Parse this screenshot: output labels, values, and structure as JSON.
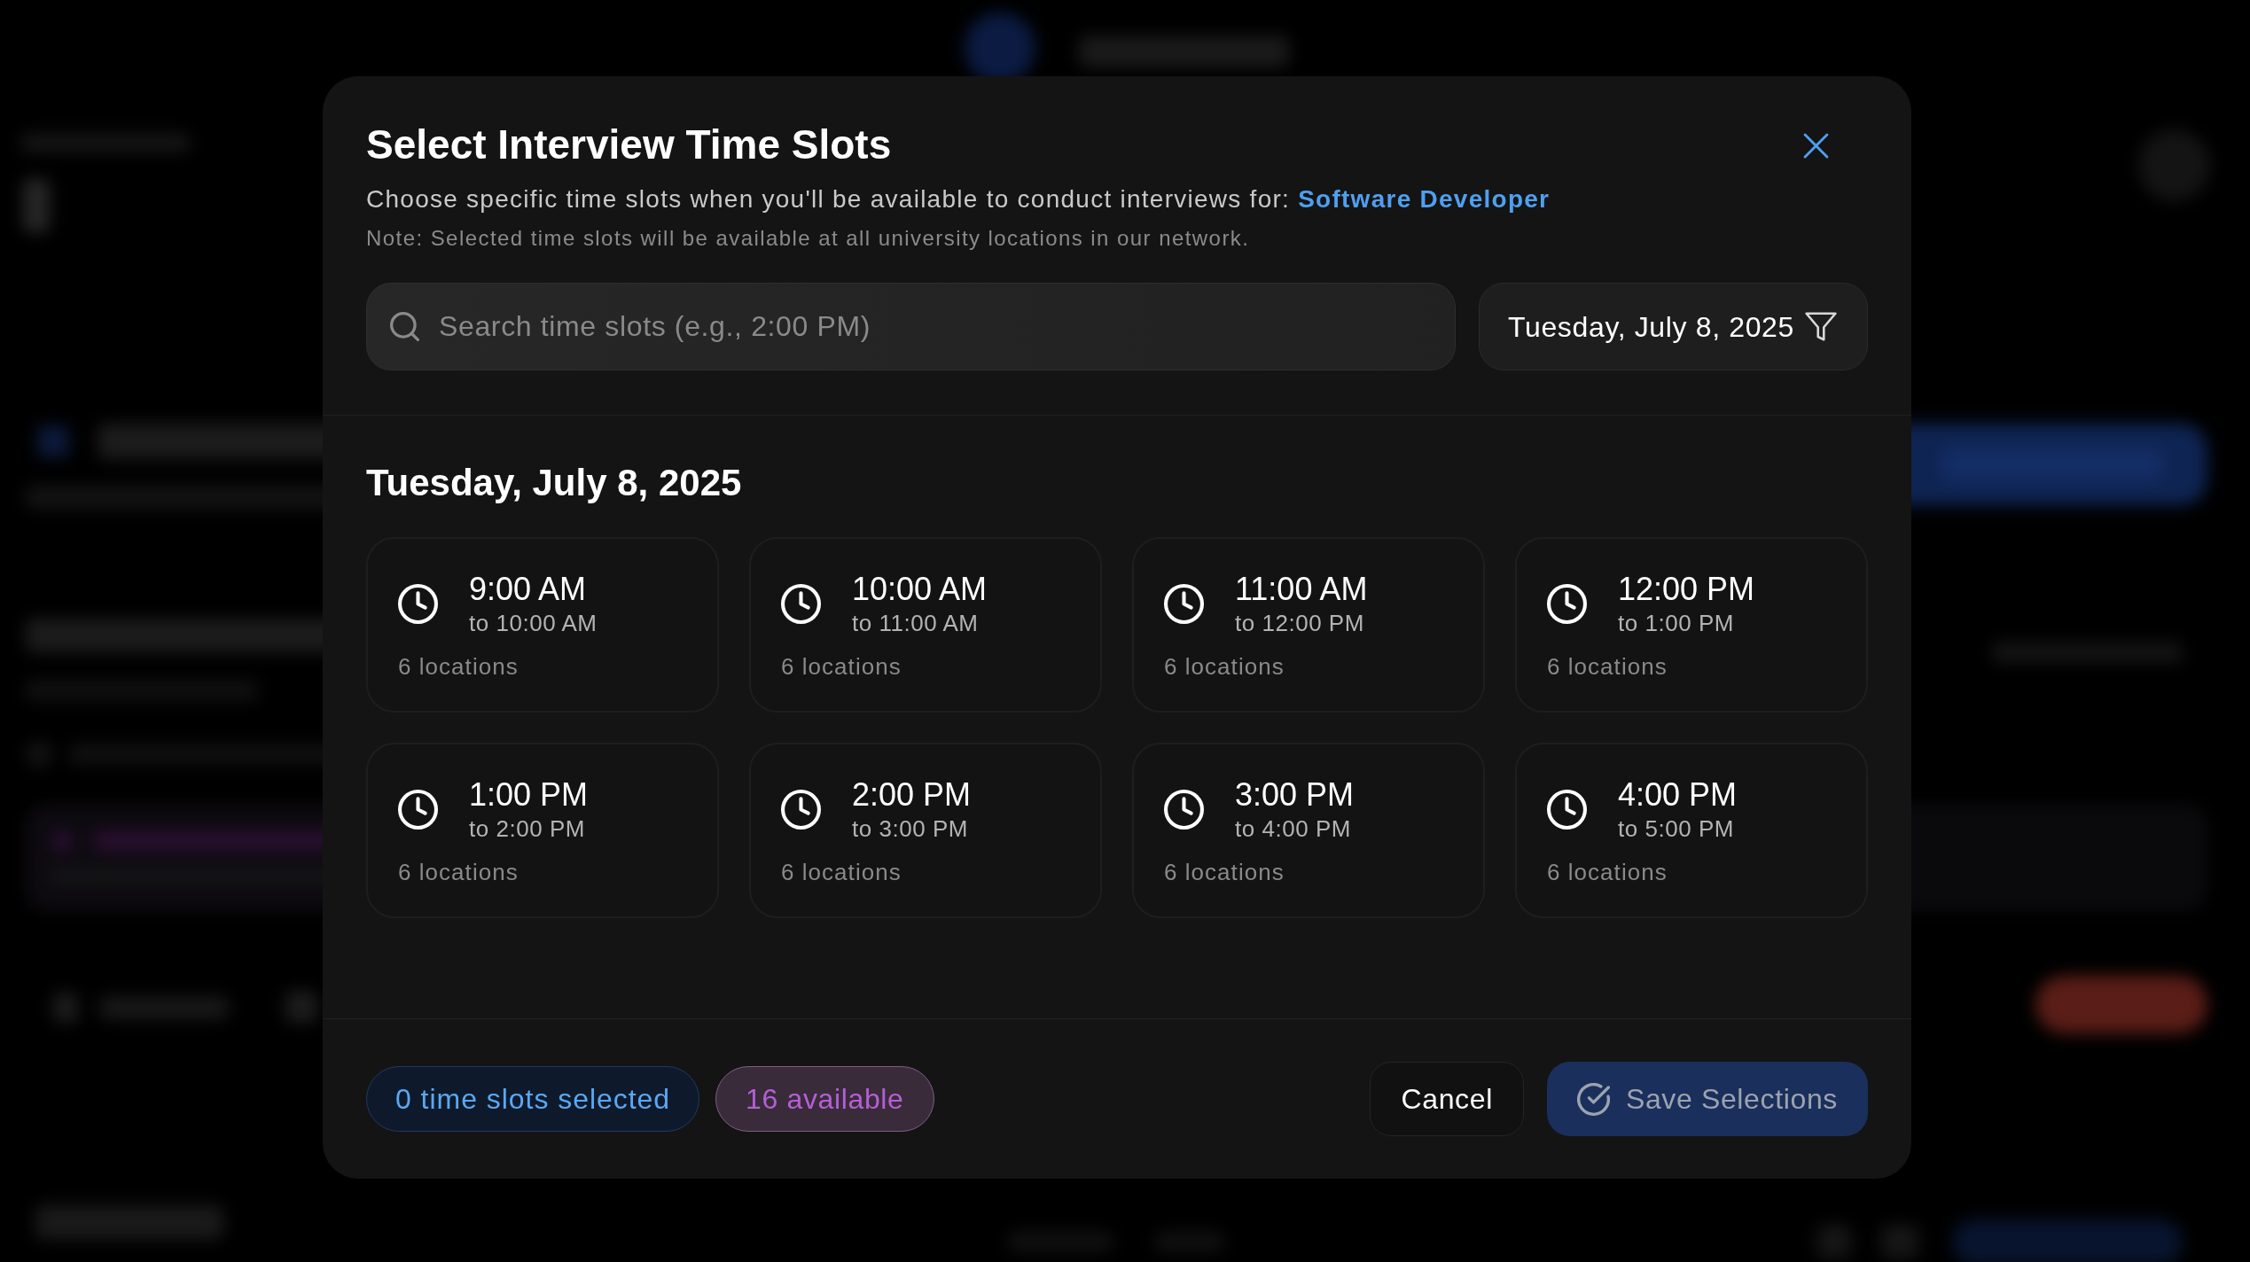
{
  "dialog": {
    "title": "Select Interview Time Slots",
    "description": "Choose specific time slots when you'll be available to conduct interviews for: **Software Developer**",
    "note": "Note: Selected time slots will be available at all university locations in our network."
  },
  "search": {
    "placeholder": "Search time slots (e.g., 2:00 PM)"
  },
  "date_filter": {
    "label": "Tuesday, July 8, 2025"
  },
  "day": {
    "heading": "Tuesday, July 8, 2025",
    "slots": [
      {
        "time": "9:00 AM",
        "end": "to 10:00 AM",
        "locations": "6 locations",
        "selected": false
      },
      {
        "time": "10:00 AM",
        "end": "to 11:00 AM",
        "locations": "6 locations",
        "selected": false
      },
      {
        "time": "11:00 AM",
        "end": "to 12:00 PM",
        "locations": "6 locations",
        "selected": false
      },
      {
        "time": "12:00 PM",
        "end": "to 1:00 PM",
        "locations": "6 locations",
        "selected": false
      },
      {
        "time": "1:00 PM",
        "end": "to 2:00 PM",
        "locations": "6 locations",
        "selected": false
      },
      {
        "time": "2:00 PM",
        "end": "to 3:00 PM",
        "locations": "6 locations",
        "selected": false
      },
      {
        "time": "3:00 PM",
        "end": "to 4:00 PM",
        "locations": "6 locations",
        "selected": false
      },
      {
        "time": "4:00 PM",
        "end": "to 5:00 PM",
        "locations": "6 locations",
        "selected": false
      }
    ]
  },
  "footer": {
    "selected_count": "0 time slots selected",
    "available_count": "16 available",
    "buttons": [
      {
        "kind": "secondary",
        "label": "Cancel",
        "disabled": false
      },
      {
        "kind": "primary",
        "label": "Save Selections",
        "disabled": true
      }
    ]
  }
}
